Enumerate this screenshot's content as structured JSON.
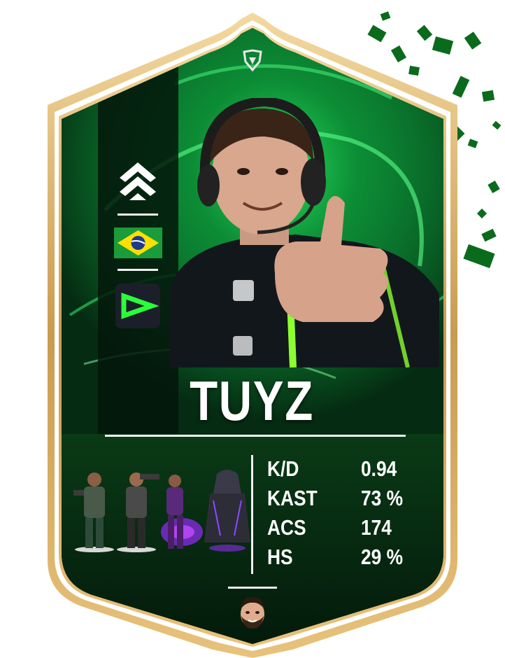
{
  "card": {
    "player_name": "TUYZ",
    "country_flag": "brazil-flag",
    "team_logo": "loud-logo",
    "role_icon": "chevron-rank-icon",
    "top_emblem": "valorant-shield-icon",
    "accent_color": "#18ff4a",
    "frame_color": "#d7b36a",
    "background_color": "#052b12"
  },
  "stats": [
    {
      "label": "K/D",
      "value": "0.94"
    },
    {
      "label": "KAST",
      "value": "73 %"
    },
    {
      "label": "ACS",
      "value": "174"
    },
    {
      "label": "HS",
      "value": "29 %"
    }
  ],
  "agents": [
    "brimstone-agent-icon",
    "brimstone-agent-icon-2",
    "reyna-agent-icon",
    "omen-agent-icon"
  ],
  "creator_avatar": "creator-avatar-icon"
}
